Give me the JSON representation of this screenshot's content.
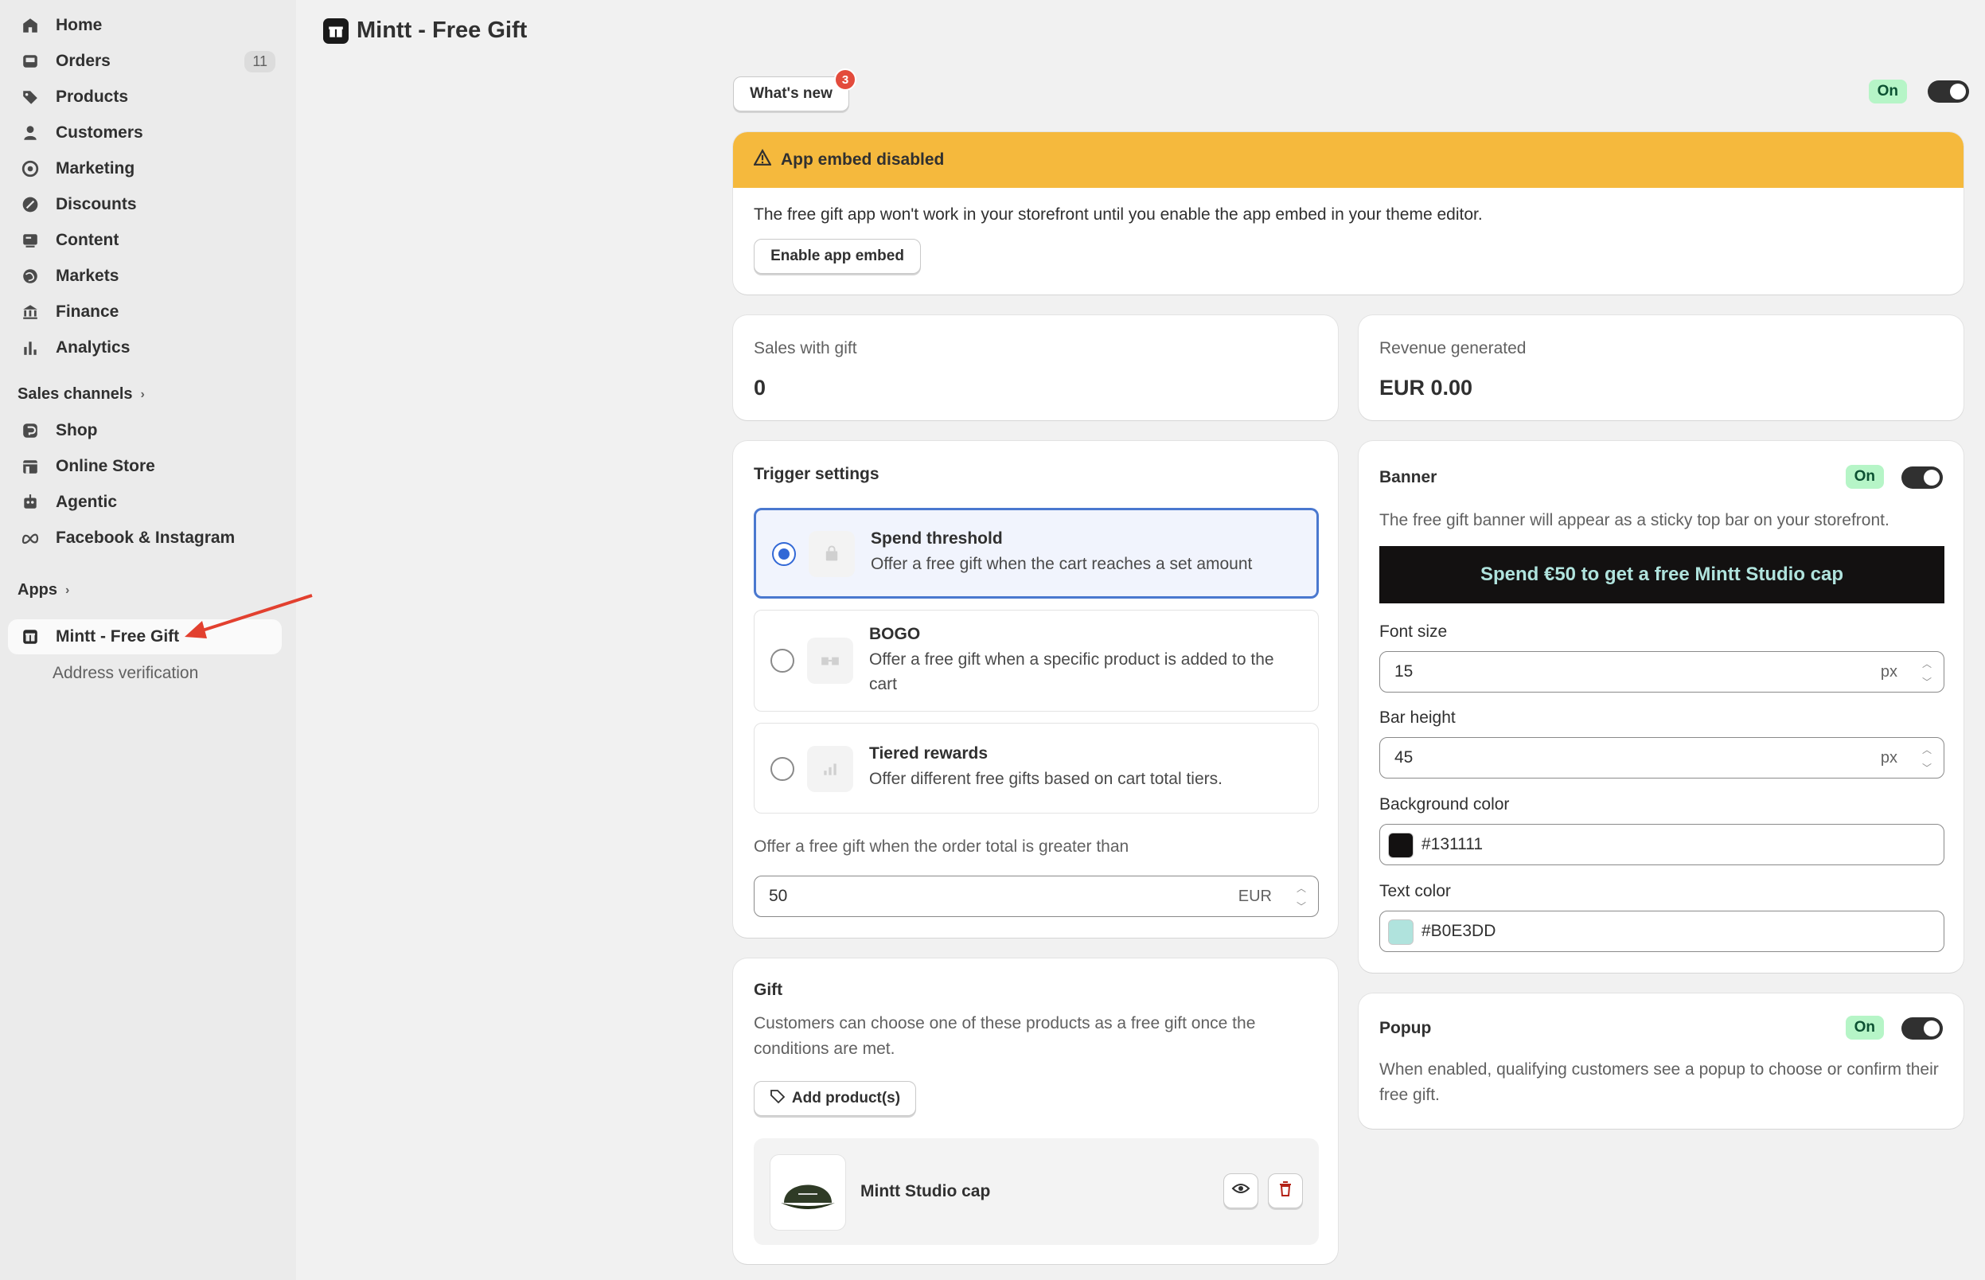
{
  "sidebar": {
    "items": [
      {
        "label": "Home",
        "icon": "home-icon"
      },
      {
        "label": "Orders",
        "icon": "inbox-icon",
        "count": "11"
      },
      {
        "label": "Products",
        "icon": "tag-icon"
      },
      {
        "label": "Customers",
        "icon": "person-icon"
      },
      {
        "label": "Marketing",
        "icon": "target-icon"
      },
      {
        "label": "Discounts",
        "icon": "discount-icon"
      },
      {
        "label": "Content",
        "icon": "content-icon"
      },
      {
        "label": "Markets",
        "icon": "globe-icon"
      },
      {
        "label": "Finance",
        "icon": "bank-icon"
      },
      {
        "label": "Analytics",
        "icon": "bar-chart-icon"
      }
    ],
    "sales_channels_label": "Sales channels",
    "channels": [
      {
        "label": "Shop",
        "icon": "shop-icon"
      },
      {
        "label": "Online Store",
        "icon": "store-icon"
      },
      {
        "label": "Agentic",
        "icon": "robot-icon"
      },
      {
        "label": "Facebook & Instagram",
        "icon": "meta-icon"
      }
    ],
    "apps_label": "Apps",
    "apps": [
      {
        "label": "Mintt - Free Gift",
        "icon": "gift-icon"
      }
    ],
    "app_sub_items": [
      "Address verification"
    ]
  },
  "page": {
    "title": "Mintt - Free Gift",
    "whats_new": "What's new",
    "whats_new_badge": "3",
    "status": "On"
  },
  "warning": {
    "title": "App embed disabled",
    "body": "The free gift app won't work in your storefront until you enable the app embed in your theme editor.",
    "button": "Enable app embed",
    "color": "#f5b93d"
  },
  "stats": {
    "sales_label": "Sales with gift",
    "sales_value": "0",
    "revenue_label": "Revenue generated",
    "revenue_value": "EUR 0.00"
  },
  "trigger": {
    "title": "Trigger settings",
    "options": [
      {
        "title": "Spend threshold",
        "desc": "Offer a free gift when the cart reaches a set amount",
        "selected": true
      },
      {
        "title": "BOGO",
        "desc": "Offer a free gift when a specific product is added to the cart",
        "selected": false
      },
      {
        "title": "Tiered rewards",
        "desc": "Offer different free gifts based on cart total tiers.",
        "selected": false
      }
    ],
    "threshold_label": "Offer a free gift when the order total is greater than",
    "threshold_value": "50",
    "currency": "EUR"
  },
  "gift": {
    "title": "Gift",
    "desc": "Customers can choose one of these products as a free gift once the conditions are met.",
    "add_button": "Add product(s)",
    "product_name": "Mintt Studio cap"
  },
  "banner": {
    "title": "Banner",
    "status": "On",
    "desc": "The free gift banner will appear as a sticky top bar on your storefront.",
    "preview_text": "Spend €50 to get a free Mintt Studio cap",
    "font_size_label": "Font size",
    "font_size": "15",
    "bar_height_label": "Bar height",
    "bar_height": "45",
    "unit": "px",
    "bg_label": "Background color",
    "bg_color": "#131111",
    "text_label": "Text color",
    "text_color": "#B0E3DD"
  },
  "popup": {
    "title": "Popup",
    "status": "On",
    "desc": "When enabled, qualifying customers see a popup to choose or confirm their free gift."
  }
}
